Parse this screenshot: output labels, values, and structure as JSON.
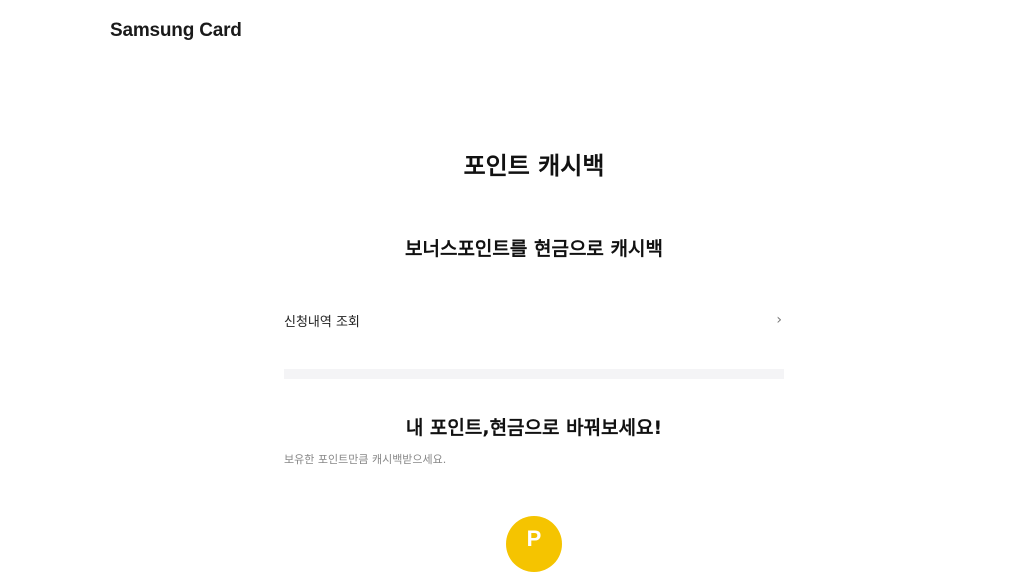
{
  "header": {
    "logo": "Samsung Card"
  },
  "page": {
    "title": "포인트 캐시백",
    "section_title": "보너스포인트를 현금으로 캐시백",
    "history_link": "신청내역 조회",
    "promo_title": "내 포인트,현금으로 바꿔보세요!",
    "promo_subtitle": "보유한 포인트만큼 캐시백받으세요.",
    "point_badge": "P"
  },
  "colors": {
    "accent": "#f5c400",
    "divider": "#f4f4f6",
    "subtext": "#888888"
  },
  "icons": {
    "history_chevron": "chevron-right-icon"
  }
}
